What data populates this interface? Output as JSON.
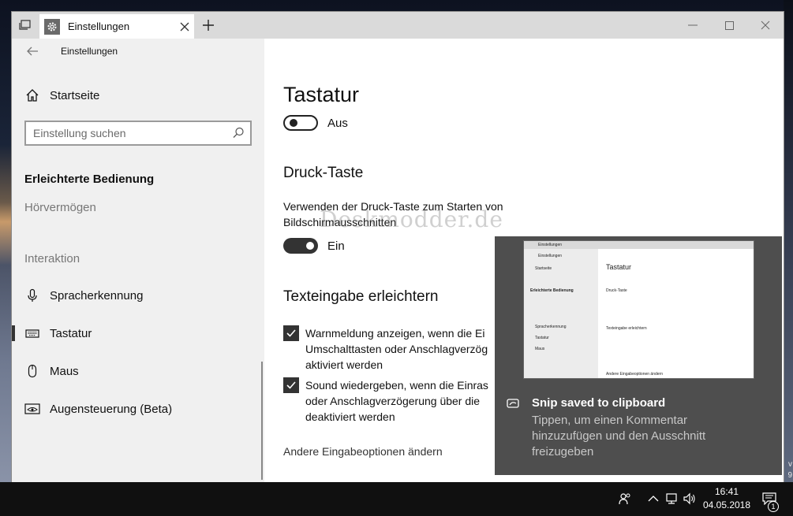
{
  "window": {
    "tab_title": "Einstellungen",
    "back_label": "Einstellungen"
  },
  "sidebar": {
    "home_label": "Startseite",
    "search_placeholder": "Einstellung suchen",
    "section_heading": "Erleichterte Bedienung",
    "hearing_label": "Hörvermögen",
    "group_label": "Interaktion",
    "items": [
      {
        "label": "Spracherkennung",
        "icon": "microphone-icon"
      },
      {
        "label": "Tastatur",
        "icon": "keyboard-icon",
        "selected": true
      },
      {
        "label": "Maus",
        "icon": "mouse-icon"
      },
      {
        "label": "Augensteuerung (Beta)",
        "icon": "eye-control-icon"
      }
    ]
  },
  "content": {
    "title": "Tastatur",
    "keyboard_toggle": {
      "state": "Aus",
      "on": false
    },
    "print_section_title": "Druck-Taste",
    "print_desc": "Verwenden der Druck-Taste zum Starten von Bildschirmausschnitten",
    "print_toggle": {
      "state": "Ein",
      "on": true
    },
    "typing_section_title": "Texteingabe erleichtern",
    "checkbox1": "Warnmeldung anzeigen, wenn die Ei Umschalttasten oder Anschlagverzög aktiviert werden",
    "checkbox1_lines": [
      "Warnmeldung anzeigen, wenn die Ei",
      "Umschalttasten oder Anschlagverzög",
      "aktiviert werden"
    ],
    "checkbox2_lines": [
      "Sound wiedergeben, wenn die Einras",
      "oder Anschlagverzögerung über die",
      "deaktiviert werden"
    ],
    "other_link": "Andere Eingabeoptionen ändern"
  },
  "watermark": "Deskmodder.de",
  "toast": {
    "title": "Snip saved to clipboard",
    "body_lines": [
      "Tippen, um einen Kommentar",
      "hinzuzufügen und den Ausschnitt",
      "freizugeben"
    ]
  },
  "taskbar": {
    "time": "16:41",
    "date": "04.05.2018",
    "notification_count": "1"
  },
  "desktop_edge": [
    "v",
    "9"
  ]
}
